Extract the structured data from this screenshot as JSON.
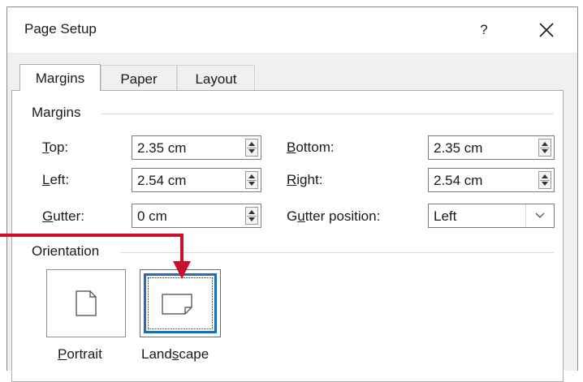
{
  "dialog": {
    "title": "Page Setup",
    "help_label": "?"
  },
  "tabs": [
    {
      "label": "Margins",
      "active": true
    },
    {
      "label": "Paper",
      "active": false
    },
    {
      "label": "Layout",
      "active": false
    }
  ],
  "margins": {
    "group_label": "Margins",
    "top": {
      "label_u": "T",
      "label_rest": "op:",
      "value": "2.35 cm"
    },
    "left": {
      "label_u": "L",
      "label_rest": "eft:",
      "value": "2.54 cm"
    },
    "gutter": {
      "label_u": "G",
      "label_rest": "utter:",
      "value": "0 cm"
    },
    "bottom": {
      "label_u": "B",
      "label_rest": "ottom:",
      "value": "2.35 cm"
    },
    "right": {
      "label_u": "R",
      "label_rest": "ight:",
      "value": "2.54 cm"
    },
    "gutter_position": {
      "label_pre": "G",
      "label_u": "u",
      "label_rest": "tter position:",
      "value": "Left"
    }
  },
  "orientation": {
    "group_label": "Orientation",
    "portrait": {
      "label_u": "P",
      "label_rest": "ortrait",
      "selected": false
    },
    "landscape": {
      "label_pre": "Land",
      "label_u": "s",
      "label_rest": "cape",
      "selected": true
    }
  },
  "colors": {
    "callout_arrow": "#c8102e",
    "selection_border": "#1d6fb8"
  }
}
